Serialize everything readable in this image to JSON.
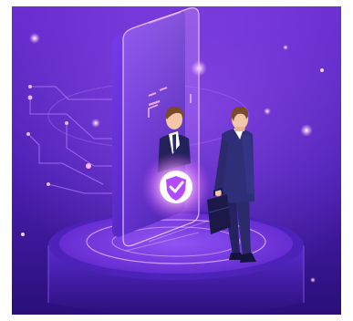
{
  "illustration": {
    "icon": "shield-check-icon",
    "colors": {
      "bg_top": "#6a2fc9",
      "bg_bottom": "#2a0f7a",
      "accent": "#c77dff",
      "glow": "#ff8cf0",
      "suit": "#2b2a6b",
      "hair": "#7a4a2a",
      "skin": "#f2c7a8"
    }
  }
}
